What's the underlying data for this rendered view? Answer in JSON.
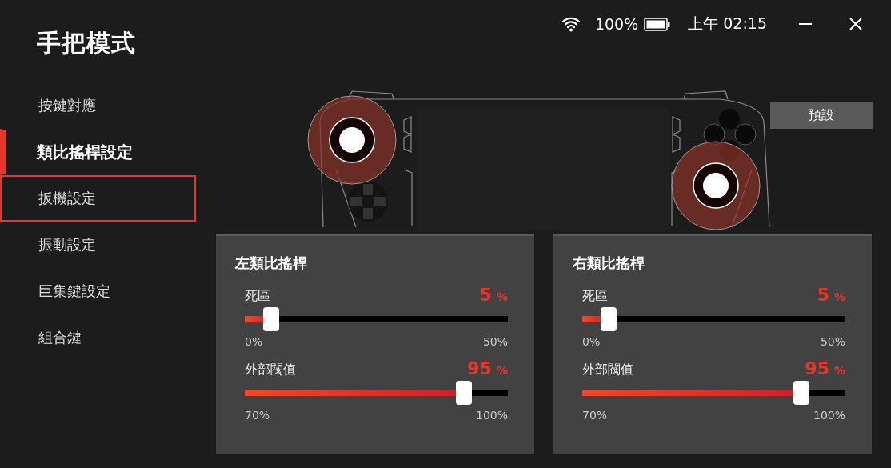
{
  "window": {
    "title": "手把模式"
  },
  "status_bar": {
    "battery": "100%",
    "time": "上午 02:15"
  },
  "sidebar": {
    "items": [
      {
        "label": "按鍵對應",
        "selected": false,
        "focused": false
      },
      {
        "label": "類比搖桿設定",
        "selected": true,
        "focused": false
      },
      {
        "label": "扳機設定",
        "selected": false,
        "focused": true
      },
      {
        "label": "振動設定",
        "selected": false,
        "focused": false
      },
      {
        "label": "巨集鍵設定",
        "selected": false,
        "focused": false
      },
      {
        "label": "組合鍵",
        "selected": false,
        "focused": false
      }
    ]
  },
  "preset_button": "預設",
  "panels": [
    {
      "title": "左類比搖桿",
      "sliders": [
        {
          "label": "死區",
          "value": "5",
          "unit": "%",
          "level": 0.1,
          "min": "0%",
          "max": "50%"
        },
        {
          "label": "外部閥值",
          "value": "95",
          "unit": "%",
          "level": 0.833,
          "min": "70%",
          "max": "100%"
        }
      ]
    },
    {
      "title": "右類比搖桿",
      "sliders": [
        {
          "label": "死區",
          "value": "5",
          "unit": "%",
          "level": 0.1,
          "min": "0%",
          "max": "50%"
        },
        {
          "label": "外部閥值",
          "value": "95",
          "unit": "%",
          "level": 0.833,
          "min": "70%",
          "max": "100%"
        }
      ]
    }
  ]
}
